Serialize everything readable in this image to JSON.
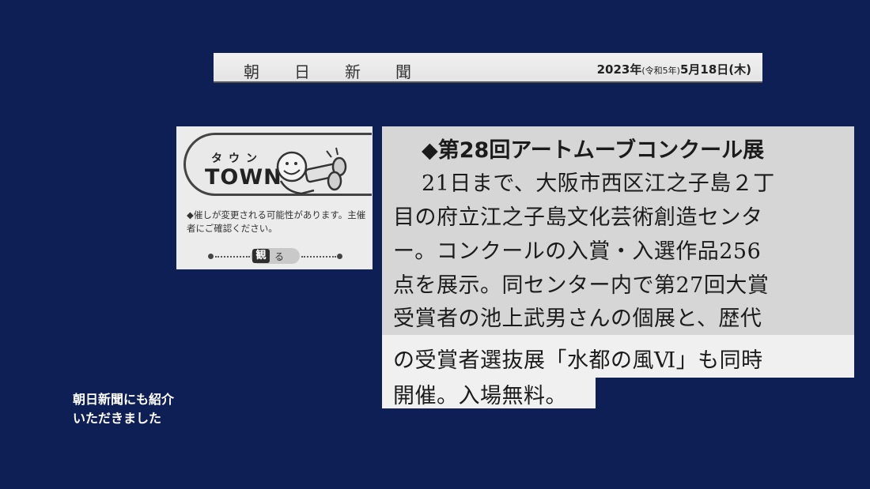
{
  "header": {
    "masthead": "朝日新聞",
    "date_main": "2023年",
    "date_era": "(令和5年)",
    "date_day": "5月18日(木)"
  },
  "town": {
    "kana": "タウン",
    "word": "TOWN",
    "note": "◆催しが変更される可能性があります。主催者にご確認ください。",
    "category_kanji": "観",
    "category_kana": "る"
  },
  "article": {
    "title": "◆第28回アートムーブコンクール展",
    "lines": [
      "21日まで、大阪市西区江之子島２丁",
      "目の府立江之子島文化芸術創造センタ",
      "ー。コンクールの入賞・入選作品256",
      "点を展示。同センター内で第27回大賞",
      "受賞者の池上武男さんの個展と、歴代",
      "の受賞者選抜展「水都の風Ⅵ」も同時",
      "開催。入場無料。"
    ]
  },
  "caption": {
    "line1": "朝日新聞にも紹介",
    "line2": "いただきました"
  },
  "colors": {
    "background": "#0d1f55",
    "paper": "#ececec",
    "ink": "#1b1b1b"
  }
}
